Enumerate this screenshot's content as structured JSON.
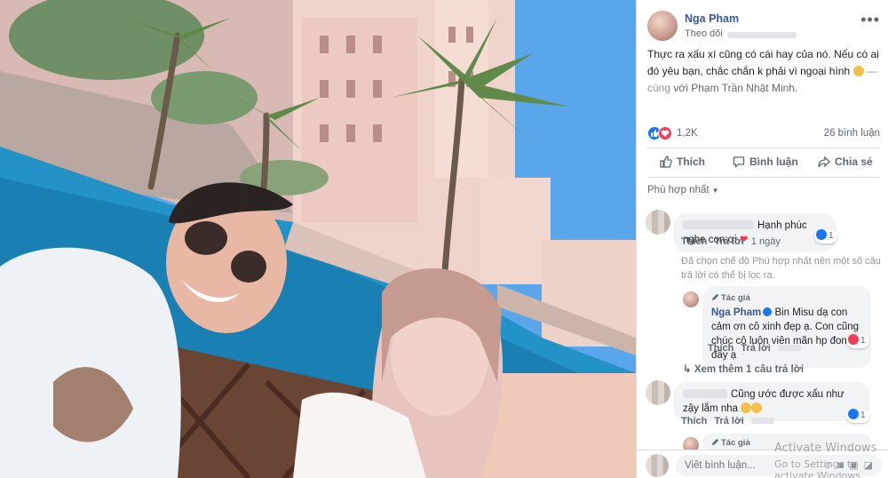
{
  "post": {
    "author": "Nga Pham",
    "follow_label": "Theo dõi",
    "caption_main": "Thực ra xấu xí cũng có cái hay của nó. Nếu có ai đó yêu bạn, chắc chắn k phải vì ngoại hình",
    "caption_with": "— cùng",
    "caption_tagged": "với Phạm Trần Nhật Minh.",
    "reaction_count": "1,2K",
    "comment_count": "26 bình luận"
  },
  "actions": {
    "like": "Thích",
    "comment": "Bình luận",
    "share": "Chia sẻ"
  },
  "sort_label": "Phù hợp nhất",
  "comments": [
    {
      "text": "Hạnh phúc nghe con ơi",
      "like_label": "Thích",
      "reply_label": "Trả lời",
      "time": "1 ngày",
      "reaction_count": "1"
    },
    {
      "notice": "Đã chọn chế độ Phù hợp nhất nên một số câu trả lời có thể bị lọc ra."
    },
    {
      "author_tag": "Tác giả",
      "name": "Nga Pham",
      "text": "Bin Misu dạ con cảm ơn cô xinh đẹp ạ. Con cũng chúc cô luôn viên mãn hp đong đầy ạ",
      "like_label": "Thích",
      "reply_label": "Trả lời",
      "reaction_count": "1"
    },
    {
      "more_replies": "Xem thêm 1 câu trả lời"
    },
    {
      "text": "Cũng ước được xấu như zậy lắm nha",
      "like_label": "Thích",
      "reply_label": "Trả lời",
      "reaction_count": "1"
    },
    {
      "author_tag": "Tác giả"
    }
  ],
  "composer": {
    "placeholder": "Viết bình luận..."
  },
  "watermark": {
    "title": "Activate Windows",
    "subtitle": "Go to Settings to activate Windows."
  },
  "colors": {
    "link": "#385898",
    "like_blue": "#1877f2",
    "heart_red": "#f33e58"
  }
}
